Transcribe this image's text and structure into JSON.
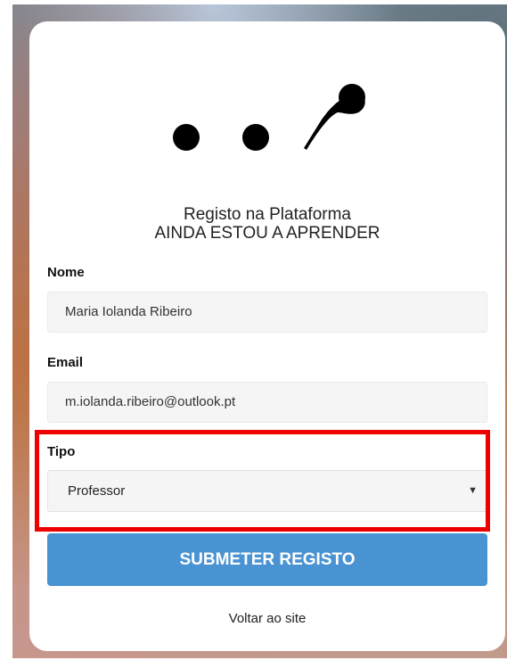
{
  "brand": {
    "logo_icon": "dots-and-stroke-logo"
  },
  "header": {
    "line1": "Registo na Plataforma",
    "line2": "AINDA ESTOU A APRENDER"
  },
  "form": {
    "name": {
      "label": "Nome",
      "value": "Maria Iolanda Ribeiro"
    },
    "email": {
      "label": "Email",
      "value": "m.iolanda.ribeiro@outlook.pt"
    },
    "type": {
      "label": "Tipo",
      "selected": "Professor"
    },
    "submit_label": "SUBMETER REGISTO"
  },
  "footer": {
    "back_link": "Voltar ao site"
  },
  "colors": {
    "button": "#4a93d3",
    "highlight": "#ee0000"
  }
}
